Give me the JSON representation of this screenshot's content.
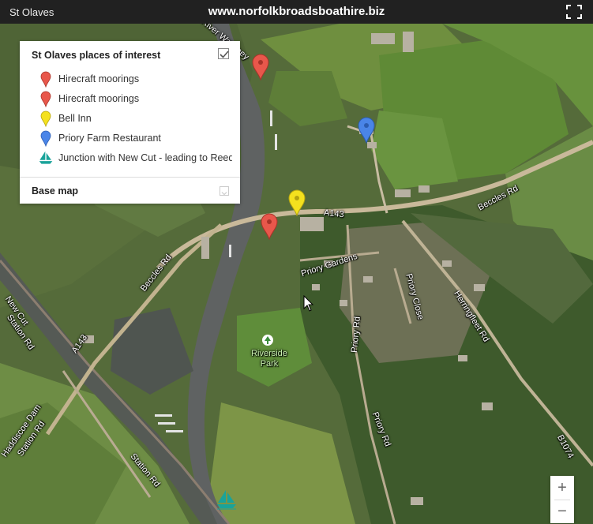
{
  "header": {
    "map_title": "St Olaves",
    "site_url": "www.norfolkbroadsboathire.biz",
    "fullscreen_icon": "fullscreen-icon"
  },
  "legend": {
    "title": "St Olaves places of interest",
    "checked": true,
    "items": [
      {
        "label": "Hirecraft moorings",
        "icon": "red-pin-icon",
        "color": "#e8574b"
      },
      {
        "label": "Hirecraft moorings",
        "icon": "red-pin-icon",
        "color": "#e8574b"
      },
      {
        "label": "Bell Inn",
        "icon": "yellow-pin-icon",
        "color": "#f4e11e"
      },
      {
        "label": "Priory Farm Restaurant",
        "icon": "blue-pin-icon",
        "color": "#4a85e8"
      },
      {
        "label": "Junction with New Cut - leading to Reedham",
        "icon": "boat-icon",
        "color": "#1aa39a"
      }
    ],
    "base_map_label": "Base map"
  },
  "map": {
    "labels": {
      "a143": "A143",
      "beccles_rd_east": "Beccles Rd",
      "beccles_rd_west": "Beccles Rd",
      "priory_gardens": "Priory Gardens",
      "priory_close": "Priory Close",
      "herringfleet_rd": "Herringfleet Rd",
      "priory_rd_1": "Priory Rd",
      "priory_rd_2": "Priory Rd",
      "riverside_park": "Riverside Park",
      "a143_west": "A143",
      "new_cut": "New Cut",
      "station_rd_1": "Station Rd",
      "station_rd_2": "Station Rd",
      "haddiscoe_dam": "Haddiscoe Dam",
      "b1074": "B1074",
      "river_waveney": "River Waveney"
    },
    "markers": [
      {
        "name": "hirecraft-moorings-north",
        "color": "#e8574b"
      },
      {
        "name": "hirecraft-moorings-south",
        "color": "#e8574b"
      },
      {
        "name": "bell-inn",
        "color": "#f4e11e"
      },
      {
        "name": "priory-farm-restaurant",
        "color": "#4a85e8"
      }
    ],
    "park_icon": "tree-icon"
  },
  "controls": {
    "zoom_in": "+",
    "zoom_out": "−"
  }
}
